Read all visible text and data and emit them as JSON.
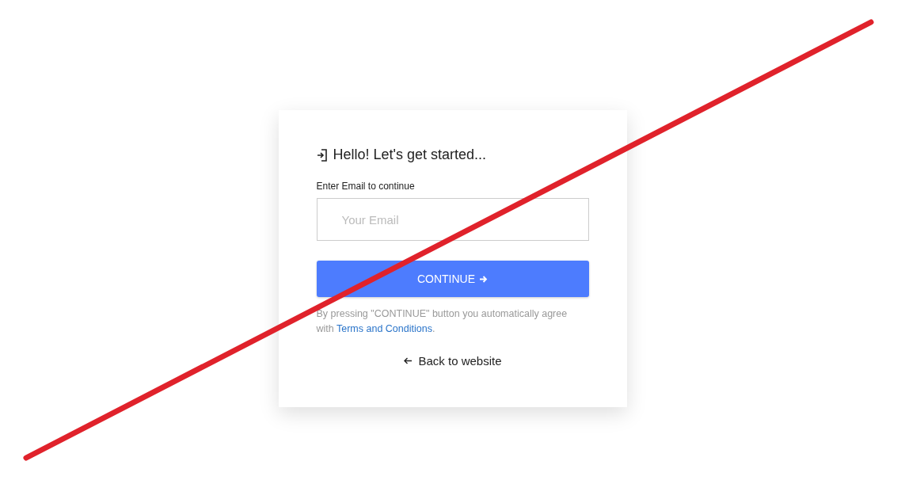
{
  "card": {
    "title": "Hello! Let's get started...",
    "email_label": "Enter Email to continue",
    "email_field": {
      "placeholder": "Your Email"
    },
    "continue_button": "CONTINUE",
    "agreement": {
      "text": "By pressing \"CONTINUE\" button you automatically agree with",
      "link": "Terms and Conditions",
      "end": "."
    },
    "back_link": "Back to website"
  }
}
